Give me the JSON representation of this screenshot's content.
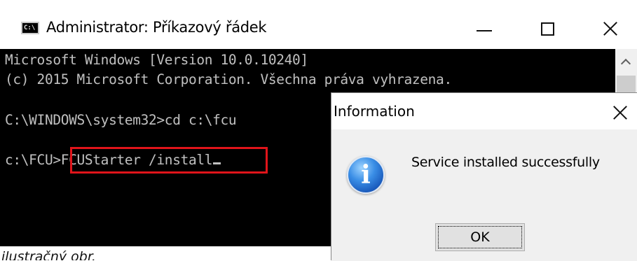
{
  "cmd_window": {
    "title": "Administrator: Příkazový řádek",
    "app_icon_text": "C:\\",
    "icon": "cmd-icon",
    "controls": {
      "minimize": "minimize-icon",
      "maximize": "maximize-icon",
      "close": "close-icon"
    }
  },
  "console": {
    "line1": "Microsoft Windows [Version 10.0.10240]",
    "line2": "(c) 2015 Microsoft Corporation. Všechna práva vyhrazena.",
    "line3": "C:\\WINDOWS\\system32>cd c:\\fcu",
    "prompt": "c:\\FCU>",
    "command": "FCUStarter /install",
    "highlight_color": "#e0141a"
  },
  "dialog": {
    "title": "Information",
    "message": "Service installed successfully",
    "ok_label": "OK",
    "icon": "information-icon",
    "icon_glyph": "i"
  },
  "caption": "ilustračný obr."
}
